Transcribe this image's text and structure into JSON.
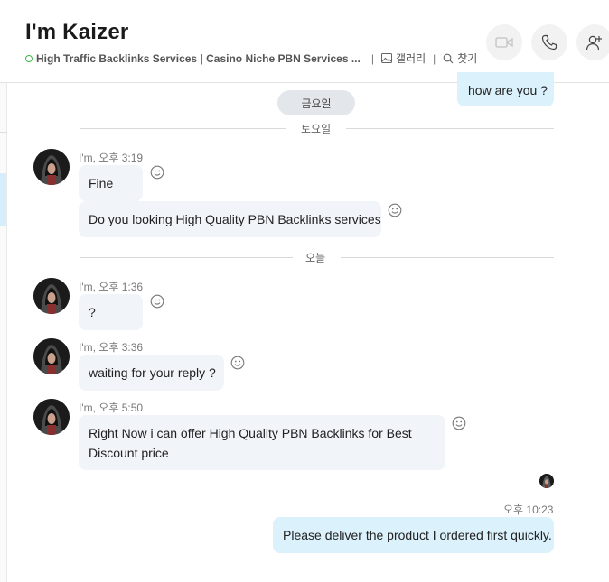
{
  "header": {
    "title": "I'm Kaizer",
    "mood": "High Traffic Backlinks Services | Casino Niche PBN Services ...",
    "gallery_label": "갤러리",
    "find_label": "찾기",
    "separator": "|"
  },
  "days": {
    "friday": "금요일",
    "saturday": "토요일",
    "today": "오늘"
  },
  "messages": {
    "out1": "how are you ?",
    "g1_meta": "I'm, 오후 3:19",
    "g1_m1": "Fine",
    "g1_m2": "Do you looking High Quality PBN Backlinks services",
    "g2_meta": "I'm, 오후 1:36",
    "g2_m1": "?",
    "g3_meta": "I'm, 오후 3:36",
    "g3_m1": "waiting for your reply ?",
    "g4_meta": "I'm, 오후 5:50",
    "g4_m1_l1": "Right Now i can offer High Quality PBN Backlinks for Best",
    "g4_m1_l2": "Discount price",
    "out2_time": "오후 10:23",
    "out2": "Please deliver the product I ordered first quickly."
  },
  "icons": {
    "video": "video-call-icon",
    "call": "phone-call-icon",
    "add_person": "add-person-icon",
    "react": "smiley-reaction-icon"
  },
  "colors": {
    "incoming_bubble": "#f1f4f8",
    "outgoing_bubble": "#dbf1fc",
    "online": "#3db84a"
  }
}
